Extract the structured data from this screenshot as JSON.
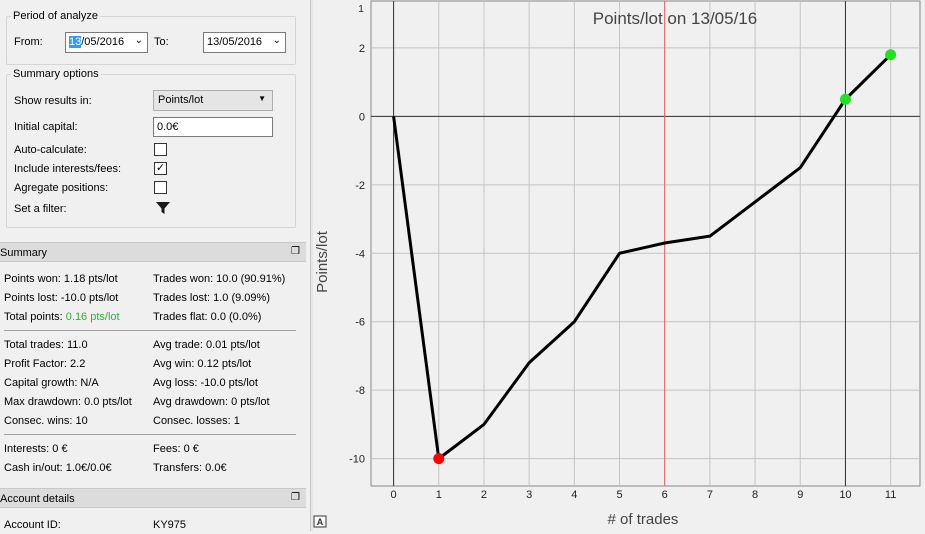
{
  "period": {
    "legend": "Period of analyze",
    "from_label": "From:",
    "from_day": "13",
    "from_rest": "/05/2016",
    "to_label": "To:",
    "to_value": "13/05/2016"
  },
  "summary_options": {
    "legend": "Summary options",
    "show_results_label": "Show results in:",
    "show_results_value": "Points/lot",
    "initial_capital_label": "Initial capital:",
    "initial_capital_value": "0.0€",
    "auto_calculate_label": "Auto-calculate:",
    "auto_calculate_checked": false,
    "include_fees_label": "Include interests/fees:",
    "include_fees_checked": true,
    "aggregate_label": "Agregate positions:",
    "aggregate_checked": false,
    "filter_label": "Set a filter:"
  },
  "summary": {
    "title": "Summary",
    "points_won": "Points won: 1.18 pts/lot",
    "trades_won": "Trades won: 10.0 (90.91%)",
    "points_lost": "Points lost: -10.0 pts/lot",
    "trades_lost": "Trades lost: 1.0 (9.09%)",
    "total_points_label": "Total points: ",
    "total_points_value": "0.16 pts/lot",
    "trades_flat": "Trades flat: 0.0 (0.0%)",
    "total_trades": "Total trades: 11.0",
    "avg_trade": "Avg trade: 0.01 pts/lot",
    "profit_factor": "Profit Factor: 2.2",
    "avg_win": "Avg win: 0.12 pts/lot",
    "capital_growth": "Capital growth: N/A",
    "avg_loss": "Avg loss: -10.0 pts/lot",
    "max_drawdown": "Max drawdown: 0.0 pts/lot",
    "avg_drawdown": "Avg drawdown: 0 pts/lot",
    "consec_wins": "Consec. wins: 10",
    "consec_losses": "Consec. losses: 1",
    "interests": "Interests: 0 €",
    "fees": "Fees: 0 €",
    "cash_in_out": "Cash in/out: 1.0€/0.0€",
    "transfers": "Transfers: 0.0€"
  },
  "account": {
    "title": "Account details",
    "id_label": "Account ID:",
    "id_value": "KY975"
  },
  "colors": {
    "line": "#000000",
    "loss_marker": "#ff0000",
    "win_marker": "#22e022",
    "center_line": "#e06060",
    "positive_text": "#2fb12f"
  },
  "chart_data": {
    "type": "line",
    "title": "Points/lot on 13/05/16",
    "xlabel": "# of trades",
    "ylabel": "Points/lot",
    "x": [
      0,
      1,
      2,
      3,
      4,
      5,
      6,
      7,
      8,
      9,
      10,
      11
    ],
    "y": [
      0.0,
      -10.0,
      -9.0,
      -7.2,
      -6.0,
      -4.0,
      -3.7,
      -3.5,
      -2.5,
      -1.5,
      0.5,
      1.8
    ],
    "xlim": [
      -0.5,
      11.65
    ],
    "ylim": [
      -10.8,
      3.4
    ],
    "xticks": [
      0,
      1,
      2,
      3,
      4,
      5,
      6,
      7,
      8,
      9,
      10,
      11
    ],
    "yticks": [
      -10,
      -8,
      -6,
      -4,
      -2,
      0,
      2
    ],
    "grid": true,
    "markers": [
      {
        "x": 1,
        "y": -10.0,
        "color": "#ff0000"
      },
      {
        "x": 10,
        "y": 0.5,
        "color": "#22e022"
      },
      {
        "x": 11,
        "y": 1.8,
        "color": "#22e022"
      }
    ],
    "vertical_line_x": 6,
    "top_axis_label": "1",
    "corner_label": "A"
  }
}
